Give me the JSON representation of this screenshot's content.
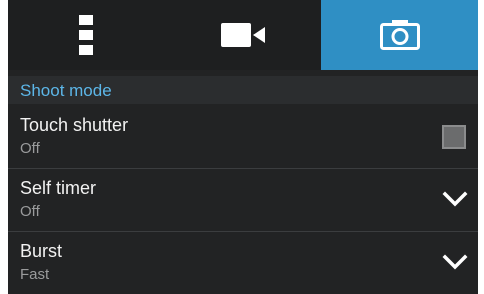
{
  "tabs": [
    {
      "icon": "settings-dots-icon",
      "active": false
    },
    {
      "icon": "video-camera-icon",
      "active": false
    },
    {
      "icon": "camera-icon",
      "active": true
    }
  ],
  "section": {
    "title": "Shoot mode"
  },
  "settings": [
    {
      "title": "Touch shutter",
      "value": "Off",
      "control": "checkbox",
      "checked": false
    },
    {
      "title": "Self timer",
      "value": "Off",
      "control": "dropdown"
    },
    {
      "title": "Burst",
      "value": "Fast",
      "control": "dropdown"
    }
  ],
  "colors": {
    "accent": "#2f8fc4",
    "section_title": "#5cb6e8",
    "background": "#222324"
  }
}
